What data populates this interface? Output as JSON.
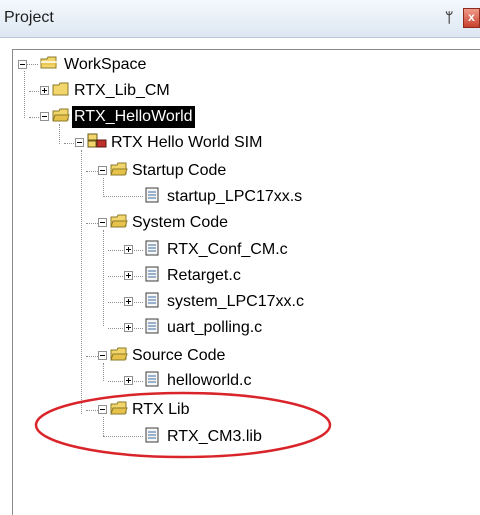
{
  "panel": {
    "title": "Project",
    "pin_glyph": "ᛘ",
    "close_glyph": "x"
  },
  "tree": {
    "workspace": "WorkSpace",
    "rtx_lib_cm": "RTX_Lib_CM",
    "rtx_helloworld": "RTX_HelloWorld",
    "target": "RTX Hello World SIM",
    "startup_group": "Startup Code",
    "startup_file": "startup_LPC17xx.s",
    "system_group": "System Code",
    "system_files": [
      "RTX_Conf_CM.c",
      "Retarget.c",
      "system_LPC17xx.c",
      "uart_polling.c"
    ],
    "source_group": "Source Code",
    "source_file": "helloworld.c",
    "lib_group": "RTX Lib",
    "lib_file": "RTX_CM3.lib"
  },
  "colors": {
    "folder": "#f2d56b",
    "selection": "#000000",
    "highlight_ellipse": "#d9242a"
  },
  "icons": {
    "expanded": "minus-box-icon",
    "collapsed": "plus-box-icon",
    "folder": "folder-icon",
    "file": "file-icon",
    "target": "target-icon"
  }
}
